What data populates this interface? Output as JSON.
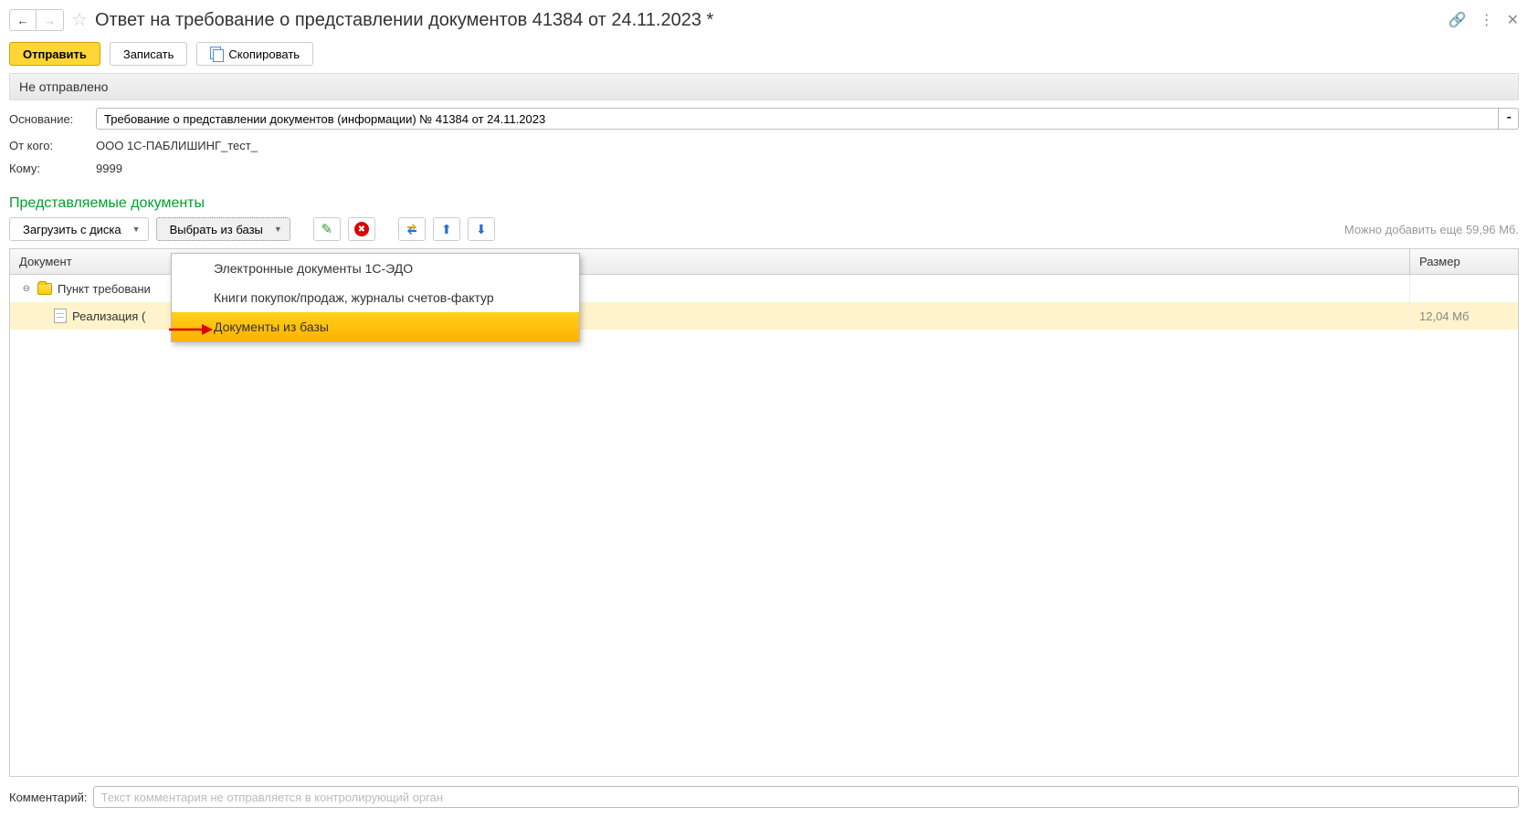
{
  "title": "Ответ на требование о представлении документов 41384 от 24.11.2023 *",
  "toolbar": {
    "send": "Отправить",
    "save": "Записать",
    "copy": "Скопировать"
  },
  "status": "Не отправлено",
  "fields": {
    "basis_label": "Основание:",
    "basis_value": "Требование о представлении документов (информации) № 41384 от 24.11.2023",
    "from_label": "От кого:",
    "from_value": "ООО 1С-ПАБЛИШИНГ_тест_",
    "to_label": "Кому:",
    "to_value": "9999"
  },
  "section_heading": "Представляемые документы",
  "doc_toolbar": {
    "load_disk": "Загрузить с диска",
    "select_db": "Выбрать из базы",
    "quota": "Можно добавить еще 59,96 Мб."
  },
  "dropdown": {
    "items": [
      "Электронные документы 1С-ЭДО",
      "Книги покупок/продаж, журналы счетов-фактур",
      "Документы из базы"
    ]
  },
  "table": {
    "col_doc": "Документ",
    "col_size": "Размер",
    "rows": [
      {
        "type": "folder",
        "label": "Пункт требовани",
        "size": ""
      },
      {
        "type": "leaf",
        "label": "Реализация (",
        "size": "12,04 Мб"
      }
    ]
  },
  "comment": {
    "label": "Комментарий:",
    "placeholder": "Текст комментария не отправляется в контролирующий орган"
  }
}
